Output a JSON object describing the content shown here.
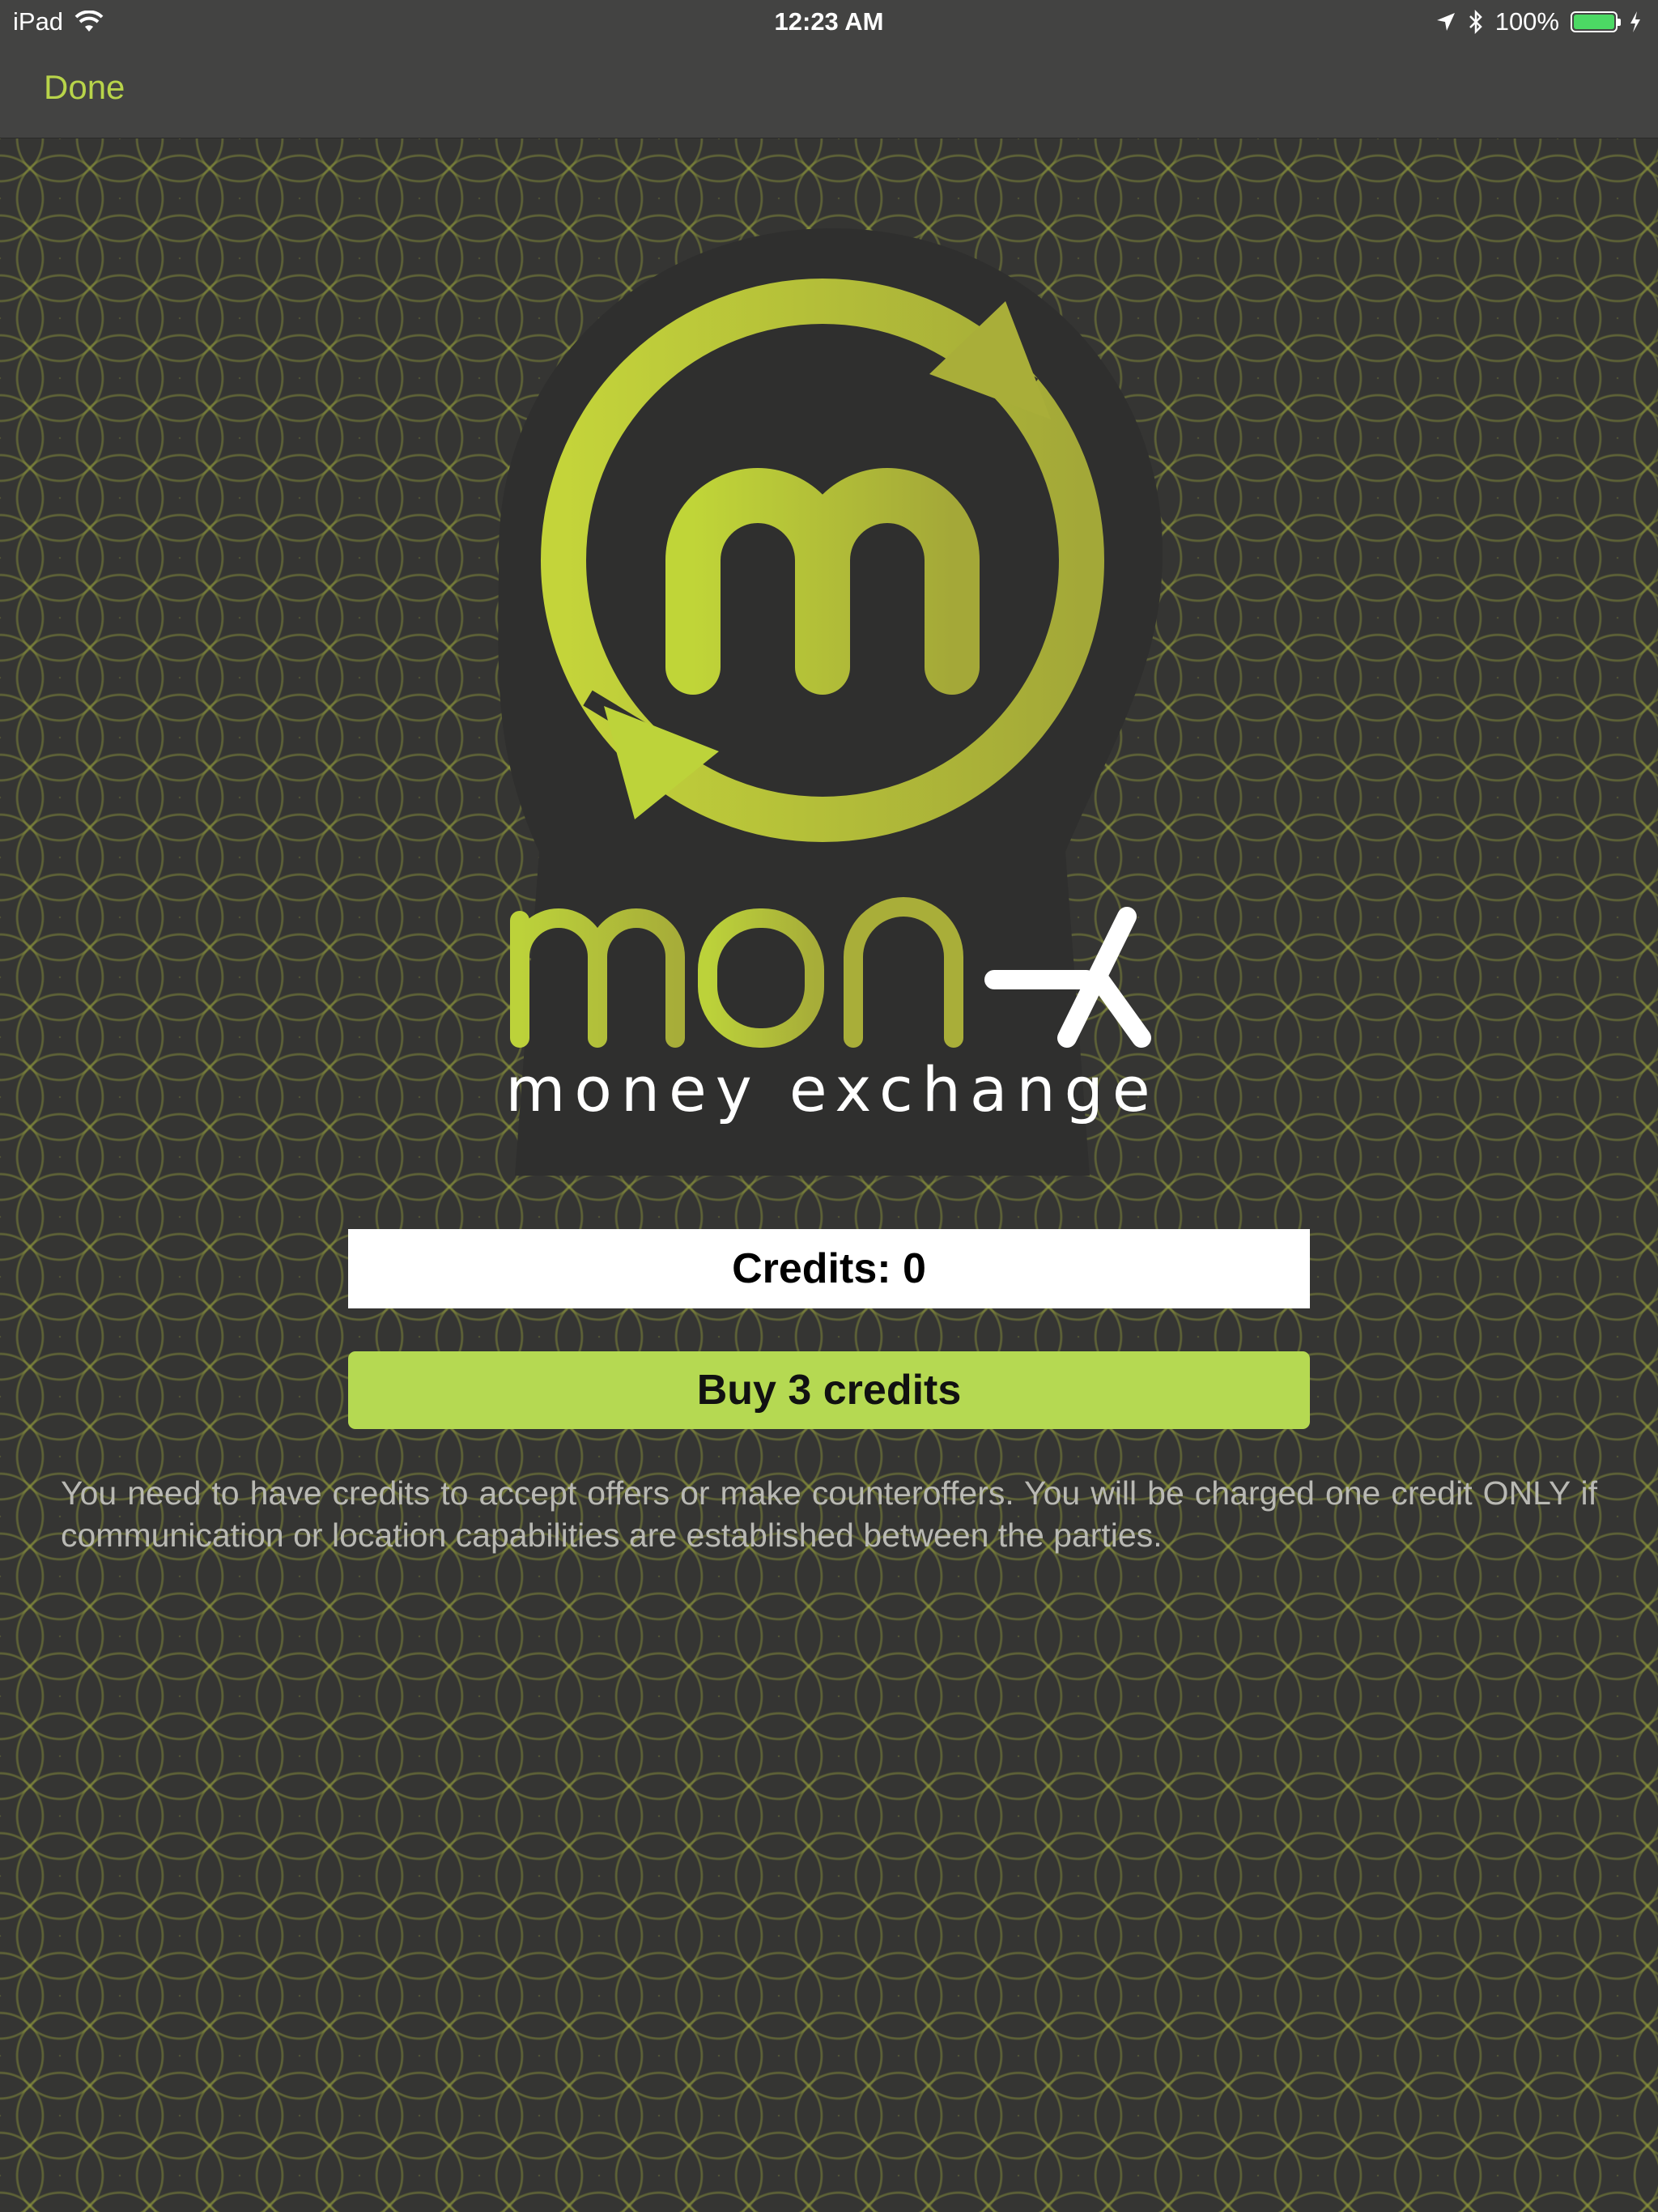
{
  "status_bar": {
    "device": "iPad",
    "time": "12:23 AM",
    "battery": "100%",
    "battery_level": 1.0,
    "icons": [
      "wifi-icon",
      "location-arrow-icon",
      "bluetooth-icon",
      "battery-icon",
      "charging-bolt-icon"
    ]
  },
  "nav": {
    "done_label": "Done"
  },
  "logo": {
    "brand": "mon-X",
    "tagline": "money exchange",
    "letter": "m",
    "accent_color": "#b8d44a"
  },
  "credits": {
    "label": "Credits: 0"
  },
  "buy": {
    "label": "Buy 3 credits"
  },
  "info": {
    "text": "You need to have credits to accept offers or make counteroffers. You will be charged one credit ONLY if communication or location capabilities are established between the parties."
  },
  "colors": {
    "background": "#333331",
    "bar": "#434342",
    "accent": "#b5d952",
    "text_muted": "#b9b9b4"
  }
}
